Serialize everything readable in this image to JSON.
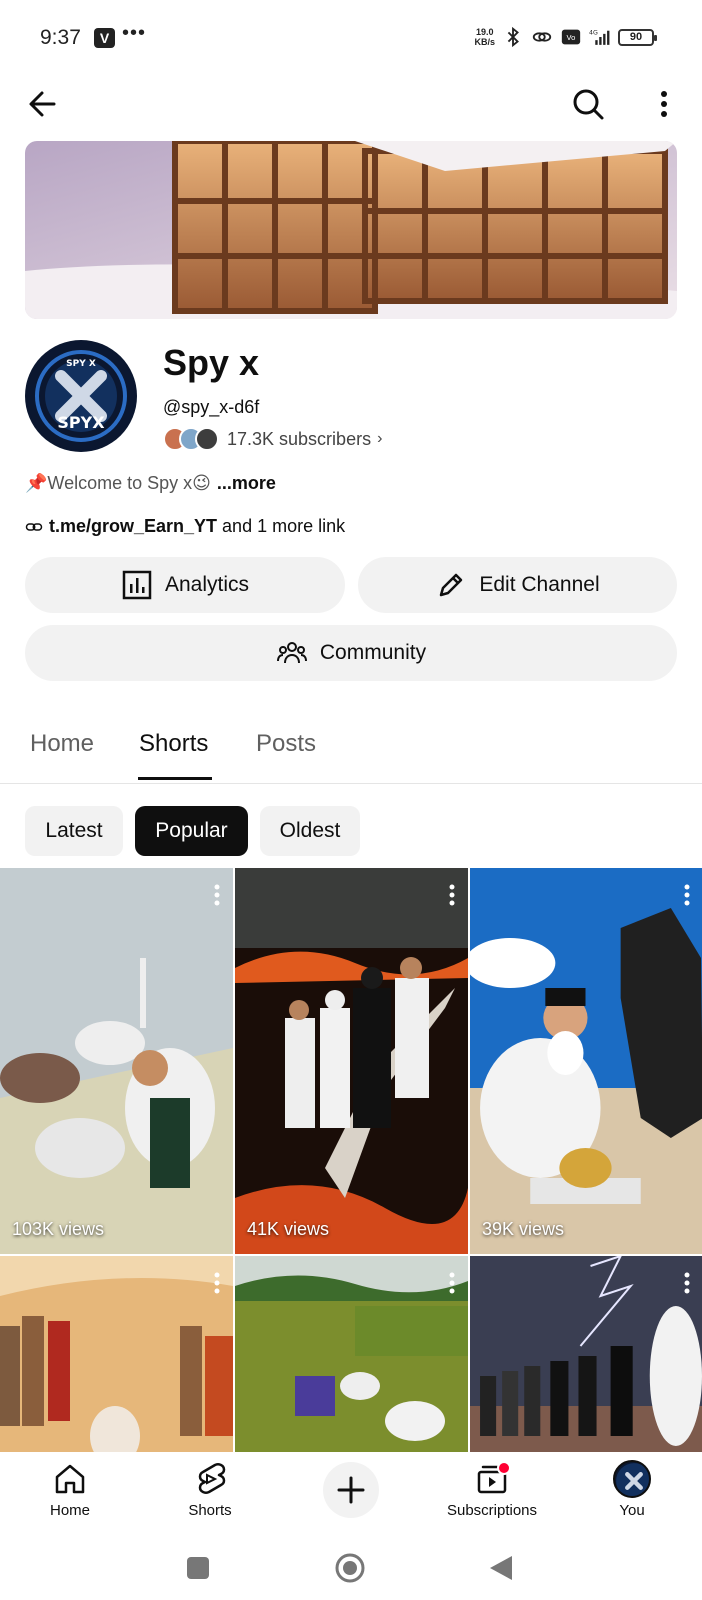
{
  "status_bar": {
    "time": "9:37",
    "app_badge": "V",
    "dots": "•••",
    "net_speed_value": "19.0",
    "net_speed_unit": "KB/s",
    "network": "4G",
    "battery": "90"
  },
  "channel": {
    "name": "Spy x",
    "handle": "@spy_x-d6f",
    "subscribers": "17.3K subscribers",
    "description": "📌Welcome to Spy x😉",
    "more_label": "...more",
    "link_text": "t.me/grow_Earn_YT",
    "link_suffix": " and 1 more link",
    "avatar_text_top": "SPY X",
    "avatar_text_bottom": "SPYX"
  },
  "actions": {
    "analytics": "Analytics",
    "edit_channel": "Edit Channel",
    "community": "Community"
  },
  "tabs": [
    {
      "label": "Home"
    },
    {
      "label": "Shorts"
    },
    {
      "label": "Posts"
    }
  ],
  "chips": [
    {
      "label": "Latest"
    },
    {
      "label": "Popular"
    },
    {
      "label": "Oldest"
    }
  ],
  "shorts": [
    {
      "views": "103K views"
    },
    {
      "views": "41K views"
    },
    {
      "views": "39K views"
    },
    {
      "views": ""
    },
    {
      "views": ""
    },
    {
      "views": ""
    }
  ],
  "bottom_nav": {
    "home": "Home",
    "shorts": "Shorts",
    "subscriptions": "Subscriptions",
    "you": "You"
  },
  "colors": {
    "accent_red": "#ff0033",
    "chip_bg": "#f2f2f2",
    "text_primary": "#0f0f0f"
  }
}
